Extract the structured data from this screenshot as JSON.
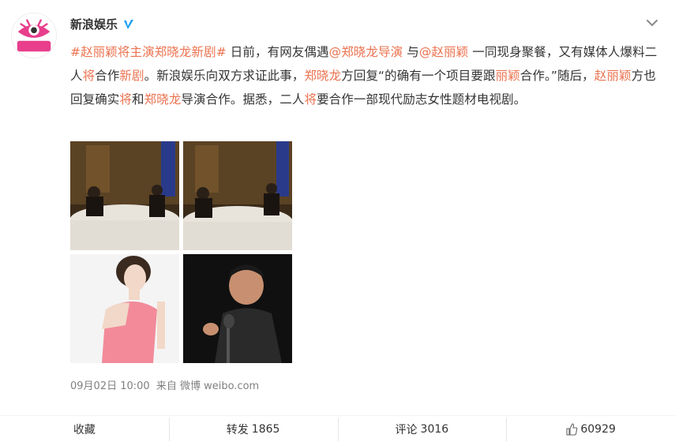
{
  "account": {
    "name": "新浪娱乐",
    "avatar_text": "新浪娱乐",
    "verified_icon": "verified-v-icon",
    "menu_icon": "chevron-down-icon"
  },
  "post": {
    "topic": "#赵丽颖将主演郑晓龙新剧#",
    "t1": " 日前，有网友偶遇",
    "mention1": "@郑晓龙导演",
    "t2": " 与",
    "mention2": "@赵丽颖",
    "t3": " 一同现身聚餐，又有媒体人爆料二人",
    "hl1": "将",
    "t4": "合作",
    "hl2": "新剧",
    "t5": "。新浪娱乐向双方求证此事，",
    "hl3": "郑晓龙",
    "t6": "方回复“的确有一个项目要跟",
    "hl4": "丽颖",
    "t7": "合作。”随后，",
    "hl5": "赵丽颖",
    "t8": "方也回复确实",
    "hl6": "将",
    "t9": "和",
    "hl7": "郑晓龙",
    "t10": "导演合作。据悉，二人",
    "hl8": "将",
    "t11": "要合作一部现代励志女性题材电视剧。"
  },
  "meta": {
    "date": "09月02日 10:00",
    "source": "来自 微博 weibo.com"
  },
  "actions": {
    "favorite": "收藏",
    "repost_label": "转发",
    "repost_count": "1865",
    "comment_label": "评论",
    "comment_count": "3016",
    "like_count": "60929"
  },
  "colors": {
    "accent": "#eb7350",
    "text": "#333333",
    "muted": "#808080"
  }
}
